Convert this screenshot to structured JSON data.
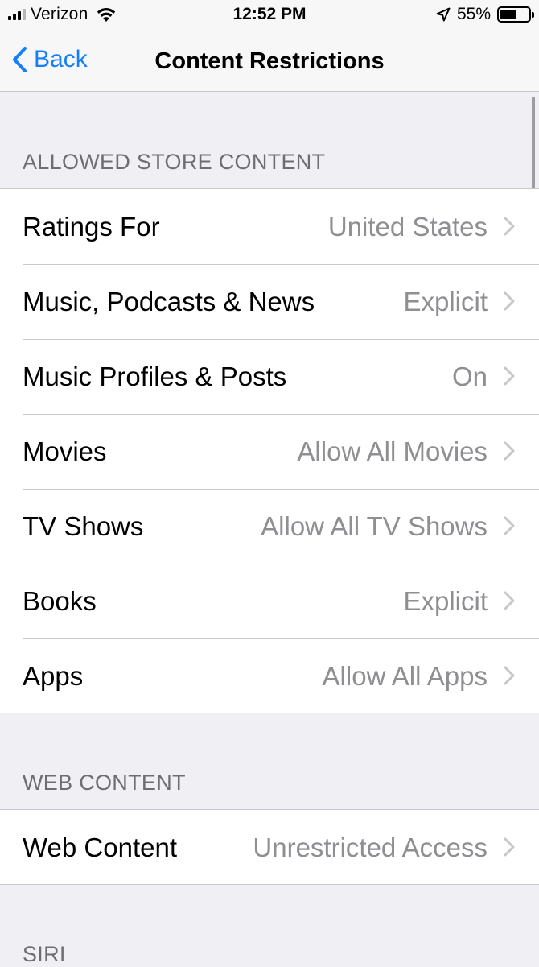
{
  "status_bar": {
    "carrier": "Verizon",
    "time": "12:52 PM",
    "battery_percent": "55%",
    "battery_level": 0.55,
    "icons": [
      "signal-icon",
      "wifi-icon",
      "location-arrow-icon",
      "battery-icon"
    ]
  },
  "nav": {
    "back_label": "Back",
    "title": "Content Restrictions"
  },
  "sections": {
    "store": {
      "header": "ALLOWED STORE CONTENT",
      "rows": [
        {
          "label": "Ratings For",
          "value": "United States"
        },
        {
          "label": "Music, Podcasts & News",
          "value": "Explicit"
        },
        {
          "label": "Music Profiles & Posts",
          "value": "On"
        },
        {
          "label": "Movies",
          "value": "Allow All Movies"
        },
        {
          "label": "TV Shows",
          "value": "Allow All TV Shows"
        },
        {
          "label": "Books",
          "value": "Explicit"
        },
        {
          "label": "Apps",
          "value": "Allow All Apps"
        }
      ]
    },
    "web": {
      "header": "WEB CONTENT",
      "rows": [
        {
          "label": "Web Content",
          "value": "Unrestricted Access"
        }
      ]
    },
    "siri": {
      "header": "SIRI"
    }
  },
  "colors": {
    "accent": "#157EFB",
    "background": "#EFEFF4",
    "secondary_text": "#8E8E93",
    "header_text": "#6D6D72",
    "separator": "#C8C7CC",
    "chevron": "#C7C7CC"
  }
}
